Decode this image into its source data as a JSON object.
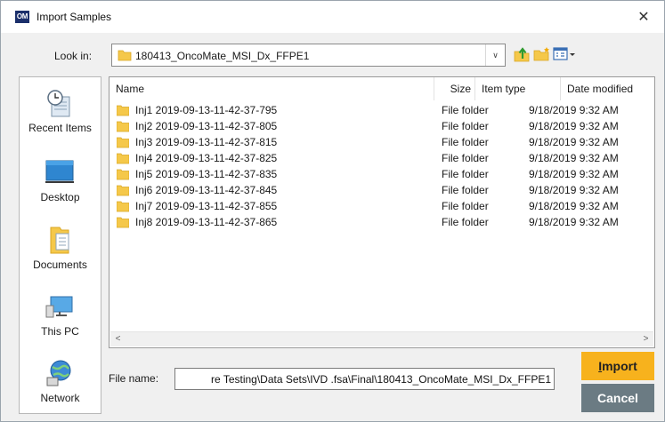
{
  "window": {
    "app_icon_text": "OM",
    "title": "Import Samples",
    "close_glyph": "✕"
  },
  "lookin": {
    "label": "Look in:",
    "value": "180413_OncoMate_MSI_Dx_FFPE1",
    "dropdown_glyph": "∨"
  },
  "toolbar": {
    "icons": [
      "up-folder-icon",
      "new-folder-icon",
      "view-menu-icon"
    ]
  },
  "places": [
    {
      "label": "Recent Items",
      "icon": "recent-items-icon"
    },
    {
      "label": "Desktop",
      "icon": "desktop-icon"
    },
    {
      "label": "Documents",
      "icon": "documents-icon"
    },
    {
      "label": "This PC",
      "icon": "computer-icon"
    },
    {
      "label": "Network",
      "icon": "network-icon"
    }
  ],
  "filelist": {
    "columns": [
      "Name",
      "Size",
      "Item type",
      "Date modified"
    ],
    "rows": [
      {
        "name": "Inj1 2019-09-13-11-42-37-795",
        "size": "",
        "type": "File folder",
        "date": "9/18/2019 9:32 AM"
      },
      {
        "name": "Inj2 2019-09-13-11-42-37-805",
        "size": "",
        "type": "File folder",
        "date": "9/18/2019 9:32 AM"
      },
      {
        "name": "Inj3 2019-09-13-11-42-37-815",
        "size": "",
        "type": "File folder",
        "date": "9/18/2019 9:32 AM"
      },
      {
        "name": "Inj4 2019-09-13-11-42-37-825",
        "size": "",
        "type": "File folder",
        "date": "9/18/2019 9:32 AM"
      },
      {
        "name": "Inj5 2019-09-13-11-42-37-835",
        "size": "",
        "type": "File folder",
        "date": "9/18/2019 9:32 AM"
      },
      {
        "name": "Inj6 2019-09-13-11-42-37-845",
        "size": "",
        "type": "File folder",
        "date": "9/18/2019 9:32 AM"
      },
      {
        "name": "Inj7 2019-09-13-11-42-37-855",
        "size": "",
        "type": "File folder",
        "date": "9/18/2019 9:32 AM"
      },
      {
        "name": "Inj8 2019-09-13-11-42-37-865",
        "size": "",
        "type": "File folder",
        "date": "9/18/2019 9:32 AM"
      }
    ],
    "scroll_left_glyph": "<",
    "scroll_right_glyph": ">"
  },
  "filename": {
    "label": "File name:",
    "value": "re Testing\\Data Sets\\IVD .fsa\\Final\\180413_OncoMate_MSI_Dx_FFPE1"
  },
  "buttons": {
    "import_label": "Import",
    "cancel_label": "Cancel"
  },
  "colors": {
    "import_button": "#f7b21d",
    "cancel_button": "#6b7b83",
    "folder": "#f5c84a"
  }
}
